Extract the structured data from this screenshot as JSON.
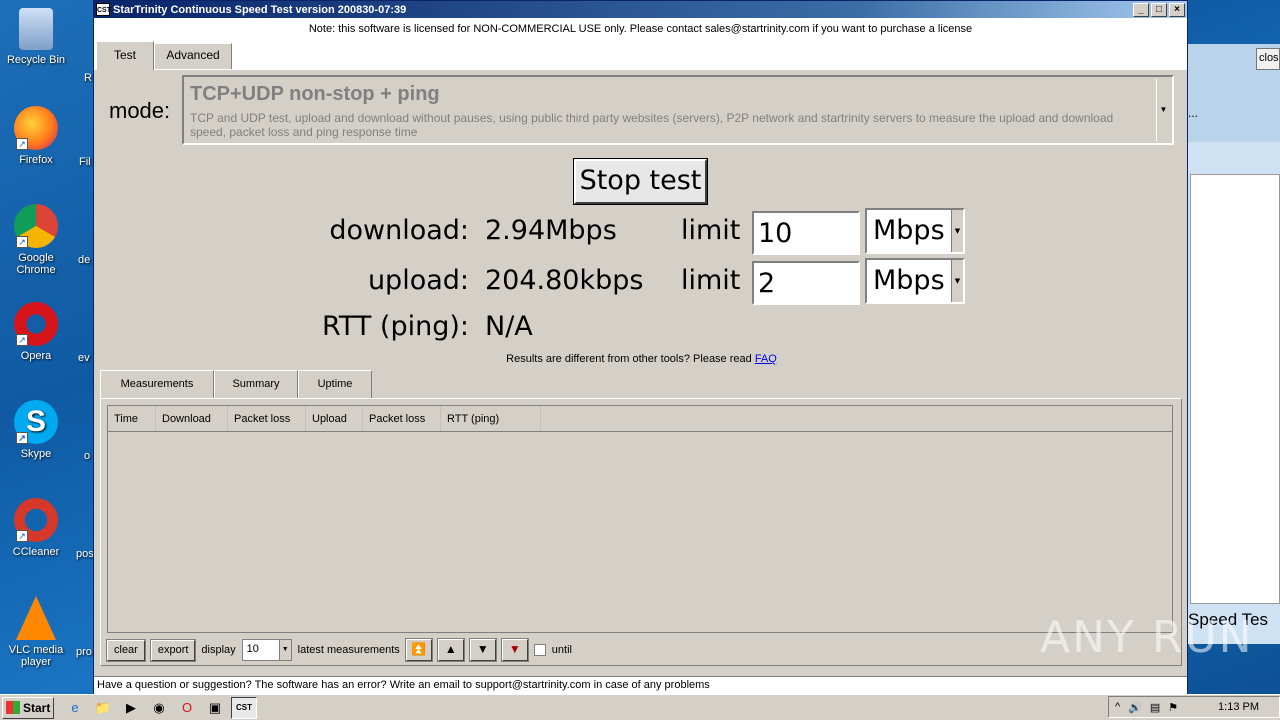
{
  "desktop": {
    "icons": [
      {
        "label": "Recycle Bin",
        "color": "#9fb8d8"
      },
      {
        "label": "Firefox",
        "color": "#ff7a1a"
      },
      {
        "label": "Google Chrome",
        "color": "#e8e8e8"
      },
      {
        "label": "Opera",
        "color": "#d8141b"
      },
      {
        "label": "Skype",
        "color": "#00a9f0"
      },
      {
        "label": "CCleaner",
        "color": "#d6382a"
      },
      {
        "label": "VLC media player",
        "color": "#ff8800"
      }
    ],
    "partial_labels": [
      "R",
      "Fil",
      "de",
      "ev",
      "o",
      "pos",
      "pro"
    ]
  },
  "background_window": {
    "close_label": "clos",
    "ellipsis": "...",
    "title_fragment": "Speed Tes"
  },
  "window": {
    "app_icon": "CST",
    "title": "StarTrinity Continuous Speed Test version 200830-07:39",
    "notice": "Note: this software is licensed for NON-COMMERCIAL USE only. Please contact sales@startrinity.com if you want to purchase a license",
    "tabs": [
      "Test",
      "Advanced"
    ],
    "active_tab": "Test"
  },
  "test": {
    "mode_label": "mode:",
    "mode_title": "TCP+UDP non-stop + ping",
    "mode_description": "TCP and UDP test, upload and download without pauses, using public third party websites (servers), P2P network and startrinity servers to measure the upload and download speed, packet loss and ping response time",
    "stop_button": "Stop test",
    "download_label": "download:",
    "download_value": "2.94Mbps",
    "upload_label": "upload:",
    "upload_value": "204.80kbps",
    "rtt_label": "RTT (ping):",
    "rtt_value": "N/A",
    "limit_label": "limit",
    "download_limit": "10",
    "download_unit": "Mbps",
    "upload_limit": "2",
    "upload_unit": "Mbps",
    "faq_text": "Results are different from other tools? Please read",
    "faq_link": "FAQ"
  },
  "results": {
    "tabs": [
      "Measurements",
      "Summary",
      "Uptime"
    ],
    "active_tab": "Measurements",
    "columns": [
      "Time",
      "Download",
      "Packet loss",
      "Upload",
      "Packet loss",
      "RTT (ping)"
    ],
    "rows": [],
    "toolbar": {
      "clear": "clear",
      "export": "export",
      "display_label": "display",
      "display_value": "10",
      "latest_label": "latest measurements",
      "until_label": "until"
    }
  },
  "status_bar": "Have a question or suggestion? The software has an error? Write an email to support@startrinity.com in case of any problems",
  "taskbar": {
    "start": "Start",
    "active_task": "CST",
    "clock": "1:13 PM"
  },
  "watermark": "ANY RUN"
}
